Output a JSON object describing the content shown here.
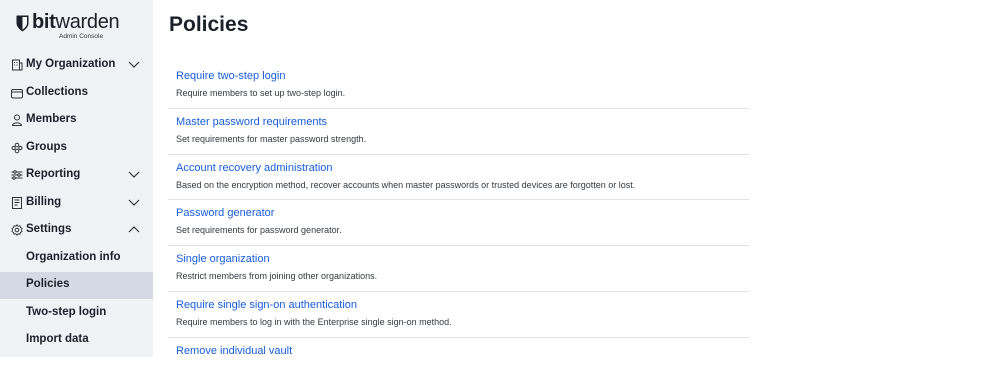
{
  "brand": {
    "name_bold": "bit",
    "name_rest": "warden",
    "subtitle": "Admin Console"
  },
  "sidebar": {
    "items": [
      {
        "label": "My Organization",
        "icon": "organization-icon",
        "expandable": true
      },
      {
        "label": "Collections",
        "icon": "collections-icon"
      },
      {
        "label": "Members",
        "icon": "members-icon"
      },
      {
        "label": "Groups",
        "icon": "groups-icon"
      },
      {
        "label": "Reporting",
        "icon": "reporting-icon",
        "expandable": true
      },
      {
        "label": "Billing",
        "icon": "billing-icon",
        "expandable": true
      },
      {
        "label": "Settings",
        "icon": "gear-icon",
        "expanded": true
      }
    ],
    "settings_children": [
      {
        "label": "Organization info"
      },
      {
        "label": "Policies",
        "active": true
      },
      {
        "label": "Two-step login"
      },
      {
        "label": "Import data"
      }
    ]
  },
  "main": {
    "title": "Policies",
    "policies": [
      {
        "name": "Require two-step login",
        "description": "Require members to set up two-step login."
      },
      {
        "name": "Master password requirements",
        "description": "Set requirements for master password strength."
      },
      {
        "name": "Account recovery administration",
        "description": "Based on the encryption method, recover accounts when master passwords or trusted devices are forgotten or lost."
      },
      {
        "name": "Password generator",
        "description": "Set requirements for password generator."
      },
      {
        "name": "Single organization",
        "description": "Restrict members from joining other organizations."
      },
      {
        "name": "Require single sign-on authentication",
        "description": "Require members to log in with the Enterprise single sign-on method."
      },
      {
        "name": "Remove individual vault",
        "description": ""
      }
    ]
  },
  "colors": {
    "link": "#175ddc",
    "sidebar_bg": "#f0f2f5",
    "active_bg": "#d3dae4"
  }
}
